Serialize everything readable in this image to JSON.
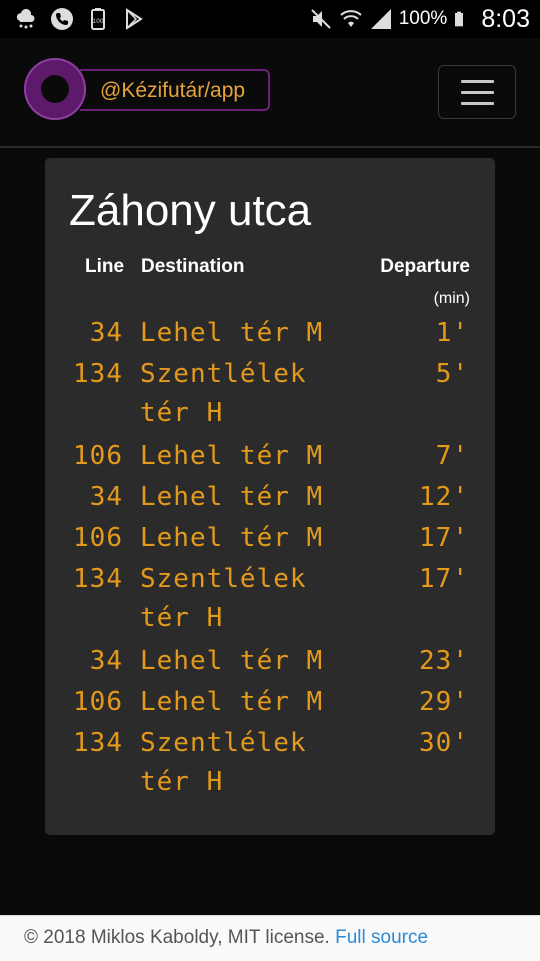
{
  "status_bar": {
    "battery_percent": "100%",
    "time": "8:03",
    "left_icons": [
      "weather-icon",
      "phone-icon",
      "battery-saver-icon",
      "play-store-icon"
    ],
    "right_icons": [
      "mute-icon",
      "wifi-icon",
      "signal-icon",
      "battery-icon"
    ]
  },
  "navbar": {
    "brand": "@Kézifutár/app"
  },
  "board": {
    "stop_name": "Záhony utca",
    "headers": {
      "line": "Line",
      "destination": "Destination",
      "departure": "Departure",
      "departure_unit": "(min)"
    },
    "rows": [
      {
        "line": "34",
        "dest1": "Lehel tér M",
        "dest2": "",
        "dep": "1'"
      },
      {
        "line": "134",
        "dest1": "Szentlélek",
        "dest2": "tér H",
        "dep": "5'"
      },
      {
        "line": "106",
        "dest1": "Lehel tér M",
        "dest2": "",
        "dep": "7'"
      },
      {
        "line": "34",
        "dest1": "Lehel tér M",
        "dest2": "",
        "dep": "12'"
      },
      {
        "line": "106",
        "dest1": "Lehel tér M",
        "dest2": "",
        "dep": "17'"
      },
      {
        "line": "134",
        "dest1": "Szentlélek",
        "dest2": "tér H",
        "dep": "17'"
      },
      {
        "line": "34",
        "dest1": "Lehel tér M",
        "dest2": "",
        "dep": "23'"
      },
      {
        "line": "106",
        "dest1": "Lehel tér M",
        "dest2": "",
        "dep": "29'"
      },
      {
        "line": "134",
        "dest1": "Szentlélek",
        "dest2": "tér H",
        "dep": "30'"
      }
    ]
  },
  "footer": {
    "text": "© 2018 Miklos Kaboldy, MIT license. ",
    "link": "Full source"
  },
  "colors": {
    "led": "#e39a1c",
    "brand": "#e6a23c",
    "link": "#2a8ad6"
  }
}
